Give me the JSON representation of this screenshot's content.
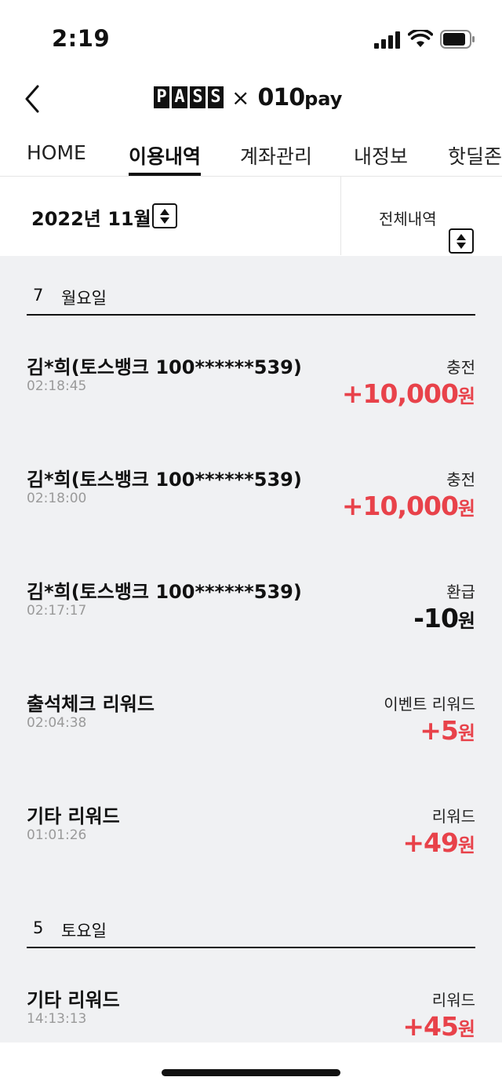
{
  "status": {
    "time": "2:19"
  },
  "header": {
    "pass_letters": [
      "P",
      "A",
      "S",
      "S"
    ],
    "times": "×",
    "pay_brand": "010",
    "pay_suffix": "pay"
  },
  "tabs": [
    "HOME",
    "이용내역",
    "계좌관리",
    "내정보",
    "핫딜존"
  ],
  "active_tab": "이용내역",
  "filter": {
    "month": "2022년 11월",
    "all": "전체내역"
  },
  "colors": {
    "positive": "#e8424a",
    "background": "#f0f1f3"
  },
  "days": [
    {
      "day": "7",
      "weekday": "월요일",
      "transactions": [
        {
          "title": "김*희(토스뱅크 100******539)",
          "time": "02:18:45",
          "type": "충전",
          "amount": "+10,000",
          "unit": "원"
        },
        {
          "title": "김*희(토스뱅크 100******539)",
          "time": "02:18:00",
          "type": "충전",
          "amount": "+10,000",
          "unit": "원"
        },
        {
          "title": "김*희(토스뱅크 100******539)",
          "time": "02:17:17",
          "type": "환급",
          "amount": "-10",
          "unit": "원"
        },
        {
          "title": "출석체크 리워드",
          "time": "02:04:38",
          "type": "이벤트 리워드",
          "amount": "+5",
          "unit": "원"
        },
        {
          "title": "기타 리워드",
          "time": "01:01:26",
          "type": "리워드",
          "amount": "+49",
          "unit": "원"
        }
      ]
    },
    {
      "day": "5",
      "weekday": "토요일",
      "transactions": [
        {
          "title": "기타 리워드",
          "time": "14:13:13",
          "type": "리워드",
          "amount": "+45",
          "unit": "원"
        }
      ]
    }
  ]
}
